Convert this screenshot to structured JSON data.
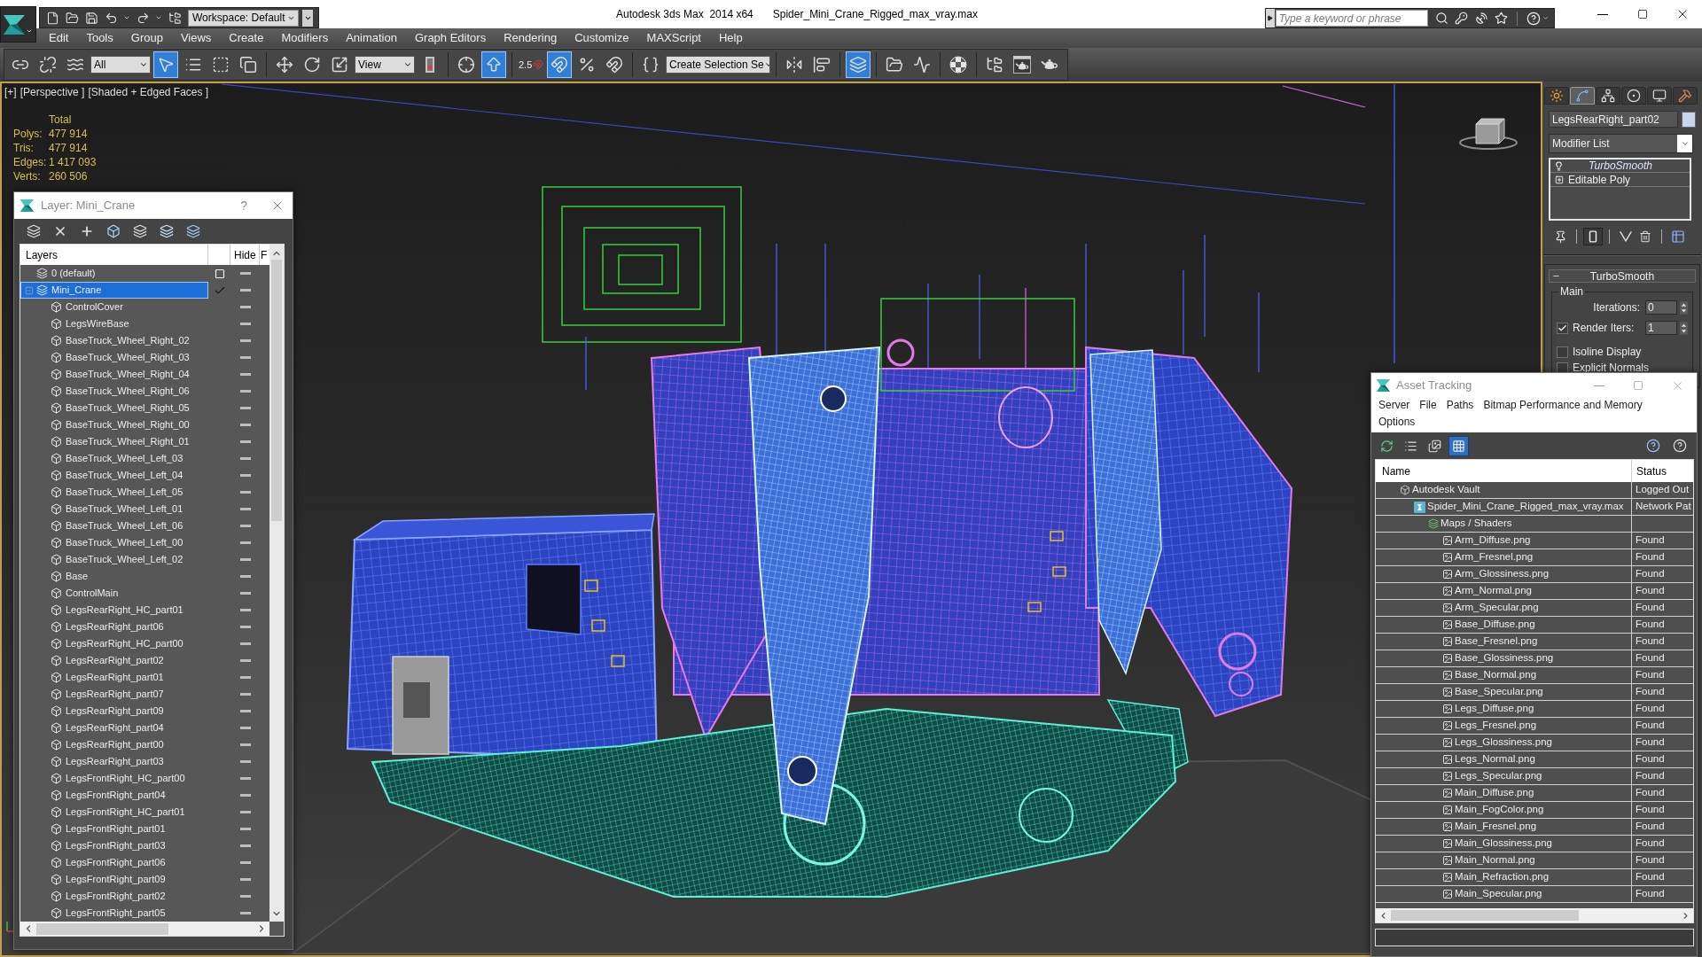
{
  "title_bar": {
    "workspace": "Workspace: Default",
    "title": "Autodesk 3ds Max  2014 x64",
    "file_name": "Spider_Mini_Crane_Rigged_max_vray.max",
    "search": {
      "placeholder": "Type a keyword or phrase"
    }
  },
  "menu": [
    "Edit",
    "Tools",
    "Group",
    "Views",
    "Create",
    "Modifiers",
    "Animation",
    "Graph Editors",
    "Rendering",
    "Customize",
    "MAXScript",
    "Help"
  ],
  "main_toolbar": [
    [
      {
        "kind": "button",
        "active": false
      },
      {
        "kind": "button",
        "active": false
      },
      {
        "kind": "button",
        "active": false
      },
      {
        "kind": "dropdown",
        "value": "All"
      },
      {
        "kind": "button",
        "active": true
      },
      {
        "kind": "button",
        "active": false
      },
      {
        "kind": "button",
        "active": false
      },
      {
        "kind": "button",
        "active": false
      }
    ],
    [
      {
        "kind": "button",
        "active": false
      },
      {
        "kind": "button",
        "active": false
      },
      {
        "kind": "button",
        "active": false
      },
      {
        "kind": "dropdown",
        "value": "View"
      },
      {
        "kind": "button",
        "active": false
      }
    ],
    [
      {
        "kind": "button",
        "active": false
      },
      {
        "kind": "button",
        "active": true
      }
    ],
    [
      {
        "kind": "button",
        "active": false,
        "text": "2.5"
      },
      {
        "kind": "button",
        "active": true
      },
      {
        "kind": "button",
        "active": false
      },
      {
        "kind": "button",
        "active": false
      }
    ],
    [
      {
        "kind": "button",
        "active": false
      },
      {
        "kind": "dropdown",
        "value": "Create Selection Se"
      }
    ],
    [
      {
        "kind": "button",
        "active": false
      },
      {
        "kind": "button",
        "active": false
      }
    ],
    [
      {
        "kind": "button",
        "active": true
      }
    ],
    [
      {
        "kind": "button",
        "active": false
      },
      {
        "kind": "button",
        "active": false
      }
    ],
    [
      {
        "kind": "button",
        "active": false
      }
    ],
    [
      {
        "kind": "button",
        "active": false
      },
      {
        "kind": "button",
        "active": false
      },
      {
        "kind": "button",
        "active": false
      }
    ]
  ],
  "viewport": {
    "labels": [
      "[+]",
      "[Perspective ]",
      "[Shaded + Edged Faces ]"
    ],
    "stats": {
      "heading": "Total",
      "rows": [
        {
          "label": "Polys:",
          "value": "477 914"
        },
        {
          "label": "Tris:",
          "value": "477 914"
        },
        {
          "label": "Edges:",
          "value": "1 417 093"
        },
        {
          "label": "Verts:",
          "value": "260 506"
        }
      ]
    }
  },
  "layer_dialog": {
    "title": "Layer: Mini_Crane",
    "help": "?",
    "columns": [
      "Layers",
      "Hide",
      "F"
    ],
    "layers": [
      {
        "name": "0 (default)",
        "selected": false,
        "current": false,
        "hidden": false
      },
      {
        "name": "Mini_Crane",
        "selected": true,
        "current": true,
        "hidden": false,
        "expanded": true,
        "children": [
          {
            "name": "ControlCover",
            "selected": false,
            "hidden": false
          },
          {
            "name": "LegsWireBase",
            "selected": false,
            "hidden": false
          },
          {
            "name": "BaseTruck_Wheel_Right_02",
            "selected": false,
            "hidden": false
          },
          {
            "name": "BaseTruck_Wheel_Right_03",
            "selected": false,
            "hidden": false
          },
          {
            "name": "BaseTruck_Wheel_Right_04",
            "selected": false,
            "hidden": false
          },
          {
            "name": "BaseTruck_Wheel_Right_06",
            "selected": false,
            "hidden": false
          },
          {
            "name": "BaseTruck_Wheel_Right_05",
            "selected": false,
            "hidden": false
          },
          {
            "name": "BaseTruck_Wheel_Right_00",
            "selected": false,
            "hidden": false
          },
          {
            "name": "BaseTruck_Wheel_Right_01",
            "selected": false,
            "hidden": false
          },
          {
            "name": "BaseTruck_Wheel_Left_03",
            "selected": false,
            "hidden": false
          },
          {
            "name": "BaseTruck_Wheel_Left_04",
            "selected": false,
            "hidden": false
          },
          {
            "name": "BaseTruck_Wheel_Left_05",
            "selected": false,
            "hidden": false
          },
          {
            "name": "BaseTruck_Wheel_Left_01",
            "selected": false,
            "hidden": false
          },
          {
            "name": "BaseTruck_Wheel_Left_06",
            "selected": false,
            "hidden": false
          },
          {
            "name": "BaseTruck_Wheel_Left_00",
            "selected": false,
            "hidden": false
          },
          {
            "name": "BaseTruck_Wheel_Left_02",
            "selected": false,
            "hidden": false
          },
          {
            "name": "Base",
            "selected": false,
            "hidden": false
          },
          {
            "name": "ControlMain",
            "selected": false,
            "hidden": false
          },
          {
            "name": "LegsRearRight_HC_part01",
            "selected": false,
            "hidden": false
          },
          {
            "name": "LegsRearRight_part06",
            "selected": false,
            "hidden": false
          },
          {
            "name": "LegsRearRight_HC_part00",
            "selected": false,
            "hidden": false
          },
          {
            "name": "LegsRearRight_part02",
            "selected": false,
            "hidden": false
          },
          {
            "name": "LegsRearRight_part01",
            "selected": false,
            "hidden": false
          },
          {
            "name": "LegsRearRight_part07",
            "selected": false,
            "hidden": false
          },
          {
            "name": "LegsRearRight_part09",
            "selected": false,
            "hidden": false
          },
          {
            "name": "LegsRearRight_part04",
            "selected": false,
            "hidden": false
          },
          {
            "name": "LegsRearRight_part00",
            "selected": false,
            "hidden": false
          },
          {
            "name": "LegsRearRight_part03",
            "selected": false,
            "hidden": false
          },
          {
            "name": "LegsFrontRight_HC_part00",
            "selected": false,
            "hidden": false
          },
          {
            "name": "LegsFrontRight_part04",
            "selected": false,
            "hidden": false
          },
          {
            "name": "LegsFrontRight_HC_part01",
            "selected": false,
            "hidden": false
          },
          {
            "name": "LegsFrontRight_part01",
            "selected": false,
            "hidden": false
          },
          {
            "name": "LegsFrontRight_part03",
            "selected": false,
            "hidden": false
          },
          {
            "name": "LegsFrontRight_part06",
            "selected": false,
            "hidden": false
          },
          {
            "name": "LegsFrontRight_part09",
            "selected": false,
            "hidden": false
          },
          {
            "name": "LegsFrontRight_part02",
            "selected": false,
            "hidden": false
          },
          {
            "name": "LegsFrontRight_part05",
            "selected": false,
            "hidden": false
          }
        ]
      }
    ]
  },
  "command_panel": {
    "tabs": [
      {
        "selected": false
      },
      {
        "selected": true
      },
      {
        "selected": false
      },
      {
        "selected": false
      },
      {
        "selected": false
      },
      {
        "selected": false
      }
    ],
    "object_name": "LegsRearRight_part02",
    "modifier_list": "Modifier List",
    "stack": [
      {
        "name": "TurboSmooth",
        "kind": "modifier",
        "enabled": true,
        "selected": false
      },
      {
        "name": "Editable Poly",
        "kind": "base_object",
        "expanded": false,
        "selected": false
      }
    ],
    "stack_tools": [
      {
        "active": false
      },
      {
        "active": true
      },
      {
        "active": false
      },
      {
        "active": false
      },
      {
        "active": false
      }
    ],
    "rollout": {
      "title": "TurboSmooth",
      "expanded": true,
      "group": "Main",
      "iterations": {
        "label": "Iterations:",
        "value": "0"
      },
      "render_iters": {
        "label": "Render Iters:",
        "value": "1",
        "checked": true
      },
      "options": [
        {
          "label": "Isoline Display",
          "checked": false
        },
        {
          "label": "Explicit Normals",
          "checked": false
        }
      ]
    }
  },
  "asset_tracking": {
    "title": "Asset Tracking",
    "menu": [
      "Server",
      "File",
      "Paths",
      "Bitmap Performance and Memory",
      "Options"
    ],
    "toolbar": [
      {
        "active": false
      },
      {
        "active": false
      },
      {
        "active": false
      },
      {
        "active": true
      }
    ],
    "columns": [
      "Name",
      "Status"
    ],
    "tree": [
      {
        "name": "Autodesk Vault",
        "status": "Logged Out",
        "selected": false,
        "children": [
          {
            "name": "Spider_Mini_Crane_Rigged_max_vray.max",
            "status": "Network Pat",
            "selected": false,
            "children": [
              {
                "name": "Maps / Shaders",
                "selected": false,
                "children": [
                  {
                    "name": "Arm_Diffuse.png",
                    "status": "Found",
                    "selected": false
                  },
                  {
                    "name": "Arm_Fresnel.png",
                    "status": "Found",
                    "selected": false
                  },
                  {
                    "name": "Arm_Glossiness.png",
                    "status": "Found",
                    "selected": false
                  },
                  {
                    "name": "Arm_Normal.png",
                    "status": "Found",
                    "selected": false
                  },
                  {
                    "name": "Arm_Specular.png",
                    "status": "Found",
                    "selected": false
                  },
                  {
                    "name": "Base_Diffuse.png",
                    "status": "Found",
                    "selected": false
                  },
                  {
                    "name": "Base_Fresnel.png",
                    "status": "Found",
                    "selected": false
                  },
                  {
                    "name": "Base_Glossiness.png",
                    "status": "Found",
                    "selected": false
                  },
                  {
                    "name": "Base_Normal.png",
                    "status": "Found",
                    "selected": false
                  },
                  {
                    "name": "Base_Specular.png",
                    "status": "Found",
                    "selected": false
                  },
                  {
                    "name": "Legs_Diffuse.png",
                    "status": "Found",
                    "selected": false
                  },
                  {
                    "name": "Legs_Fresnel.png",
                    "status": "Found",
                    "selected": false
                  },
                  {
                    "name": "Legs_Glossiness.png",
                    "status": "Found",
                    "selected": false
                  },
                  {
                    "name": "Legs_Normal.png",
                    "status": "Found",
                    "selected": false
                  },
                  {
                    "name": "Legs_Specular.png",
                    "status": "Found",
                    "selected": false
                  },
                  {
                    "name": "Main_Diffuse.png",
                    "status": "Found",
                    "selected": false
                  },
                  {
                    "name": "Main_FogColor.png",
                    "status": "Found",
                    "selected": false
                  },
                  {
                    "name": "Main_Fresnel.png",
                    "status": "Found",
                    "selected": false
                  },
                  {
                    "name": "Main_Glossiness.png",
                    "status": "Found",
                    "selected": false
                  },
                  {
                    "name": "Main_Normal.png",
                    "status": "Found",
                    "selected": false
                  },
                  {
                    "name": "Main_Refraction.png",
                    "status": "Found",
                    "selected": false
                  },
                  {
                    "name": "Main_Specular.png",
                    "status": "Found",
                    "selected": false
                  }
                ]
              }
            ]
          }
        ]
      }
    ]
  }
}
